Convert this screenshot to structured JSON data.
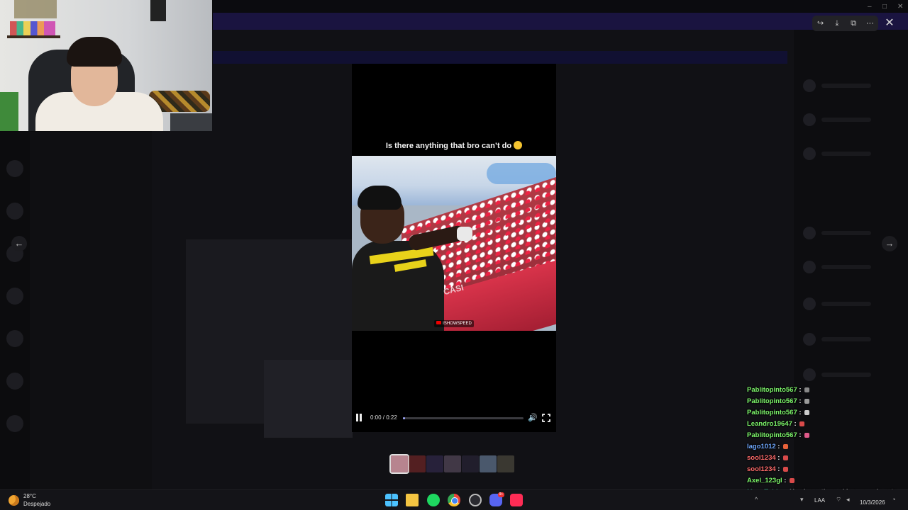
{
  "viewer": {
    "video_caption": "Is there anything that bro can’t do",
    "time_label": "0:00 / 0:22",
    "progress": 0.02,
    "clip_watermark": "ISHOWSPEED",
    "wall_text": "CASI",
    "thumbnail_count": 7,
    "tools": [
      "share-icon",
      "download-icon",
      "open-external-icon",
      "more-icon"
    ]
  },
  "chat": {
    "messages": [
      {
        "user": "Pablitopinto567",
        "text": "",
        "color": "#7cf46a",
        "badge": "#888888"
      },
      {
        "user": "Pablitopinto567",
        "text": "",
        "color": "#7cf46a",
        "badge": "#9a9a9a"
      },
      {
        "user": "Pablitopinto567",
        "text": "",
        "color": "#7cf46a",
        "badge": "#cccccc"
      },
      {
        "user": "Leandro19647",
        "text": "",
        "color": "#7cf46a",
        "badge": "#d94a4a"
      },
      {
        "user": "Pablitopinto567",
        "text": "",
        "color": "#7cf46a",
        "badge": "#e05a8a"
      },
      {
        "user": "lago1012",
        "text": "",
        "color": "#6fa8ff",
        "badge": "#e8623a"
      },
      {
        "user": "sool1234",
        "text": "",
        "color": "#ff6b6b",
        "badge": "#d94a4a"
      },
      {
        "user": "sool1234",
        "text": "",
        "color": "#ff6b6b",
        "badge": "#d94a4a"
      },
      {
        "user": "Axel_123gl",
        "text": "",
        "color": "#7cf46a",
        "badge": "#d94a4a"
      },
      {
        "user": "ManyTubby",
        "text": "Yo el que tiene el humor más roto",
        "color": "#3fd3a6",
        "badge": ""
      }
    ]
  },
  "taskbar": {
    "weather_temp": "28°C",
    "weather_desc": "Despejado",
    "tray_lang": "LAA",
    "date": "10/3/2026",
    "discord_badge": "9+",
    "apps": [
      "start-icon",
      "file-explorer-icon",
      "spotify-icon",
      "chrome-icon",
      "obs-icon",
      "discord-icon",
      "tiktok-icon"
    ]
  },
  "colors": {
    "accent": "#a0a8ff",
    "discord": "#5865f2"
  }
}
